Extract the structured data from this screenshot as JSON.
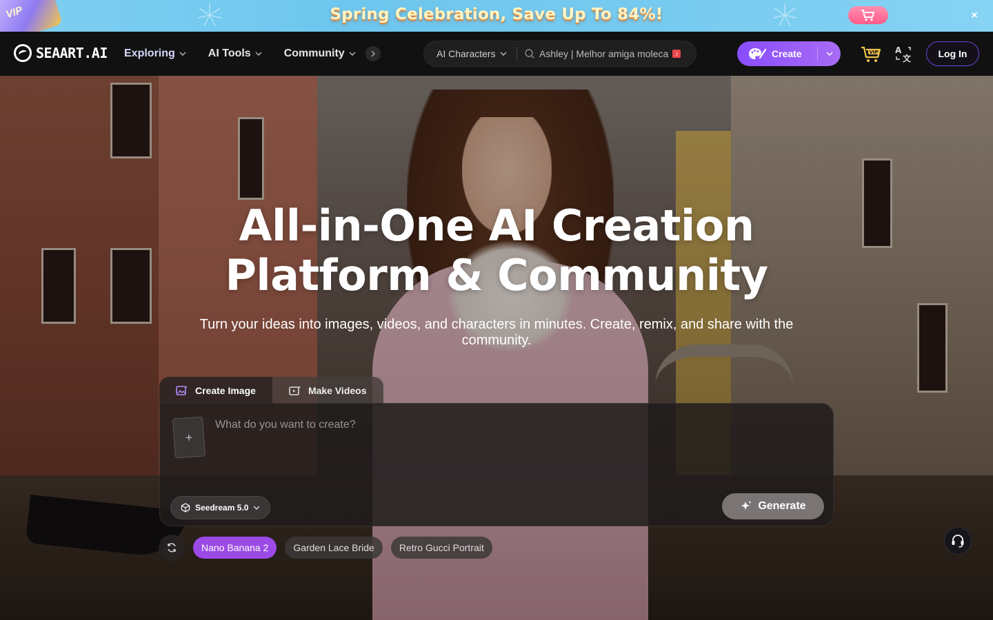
{
  "promo": {
    "vip_text": "VIP",
    "title": "Spring Celebration, Save Up To 84%!",
    "close_symbol": "×",
    "cart_icon": "cart-icon",
    "colors": {
      "background": "#7fd0f2",
      "title": "#fff5c6",
      "cart_button": "#ff5b8a"
    }
  },
  "nav": {
    "logo_text": "SEAART.AI",
    "menu": [
      {
        "label": "Exploring",
        "active": true
      },
      {
        "label": "AI Tools",
        "active": false
      },
      {
        "label": "Community",
        "active": false
      }
    ],
    "search": {
      "category": "AI Characters",
      "query": "Ashley | Melhor amiga moleca"
    },
    "create_label": "Create",
    "login_label": "Log In",
    "icons": [
      "palette-icon",
      "vip-cart-icon",
      "translate-icon",
      "search-icon",
      "chevron-down-icon",
      "chevron-right-icon"
    ],
    "colors": {
      "create_button": "#8a4dff",
      "login_border": "#6b44d6"
    }
  },
  "hero": {
    "headline_line1": "All-in-One AI Creation",
    "headline_line2": "Platform & Community",
    "subline": "Turn your ideas into images, videos, and characters in minutes. Create, remix, and share with the community."
  },
  "composer": {
    "tabs": [
      {
        "label": "Create Image",
        "active": true
      },
      {
        "label": "Make Videos",
        "active": false
      }
    ],
    "upload_symbol": "+",
    "prompt_placeholder": "What do you want to create?",
    "model": "Seedream 5.0",
    "generate_label": "Generate"
  },
  "suggestions": [
    {
      "label": "Nano Banana 2",
      "active": true
    },
    {
      "label": "Garden Lace Bride",
      "active": false
    },
    {
      "label": "Retro Gucci Portrait",
      "active": false
    }
  ],
  "accent_color": "#9b4ae6"
}
